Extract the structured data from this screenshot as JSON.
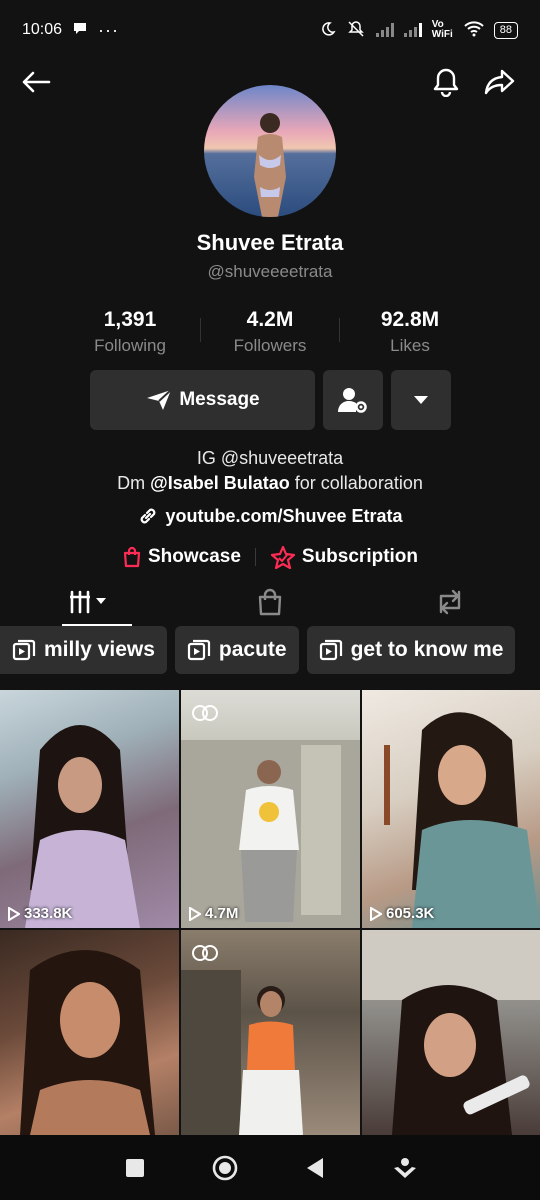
{
  "status": {
    "time": "10:06",
    "battery": "88",
    "network": "Vo WiFi"
  },
  "profile": {
    "name": "Shuvee Etrata",
    "handle": "@shuveeeetrata",
    "stats": [
      {
        "value": "1,391",
        "label": "Following"
      },
      {
        "value": "4.2M",
        "label": "Followers"
      },
      {
        "value": "92.8M",
        "label": "Likes"
      }
    ],
    "message_label": "Message",
    "bio_line1": "IG @shuveeetrata",
    "bio_line2_prefix": "Dm",
    "bio_line2_mention": "@Isabel Bulatao",
    "bio_line2_suffix": "for collaboration",
    "link": "youtube.com/Shuvee Etrata",
    "showcase_label": "Showcase",
    "subscription_label": "Subscription"
  },
  "playlists": [
    "milly views",
    "pacute",
    "get to know me"
  ],
  "videos": [
    {
      "views": "333.8K"
    },
    {
      "views": "4.7M"
    },
    {
      "views": "605.3K"
    },
    {
      "views": ""
    },
    {
      "views": ""
    },
    {
      "views": ""
    }
  ],
  "colors": {
    "background": "#121212",
    "button": "#2f2f2f",
    "muted": "#8a8a8a",
    "accent_red": "#fe2c55"
  }
}
